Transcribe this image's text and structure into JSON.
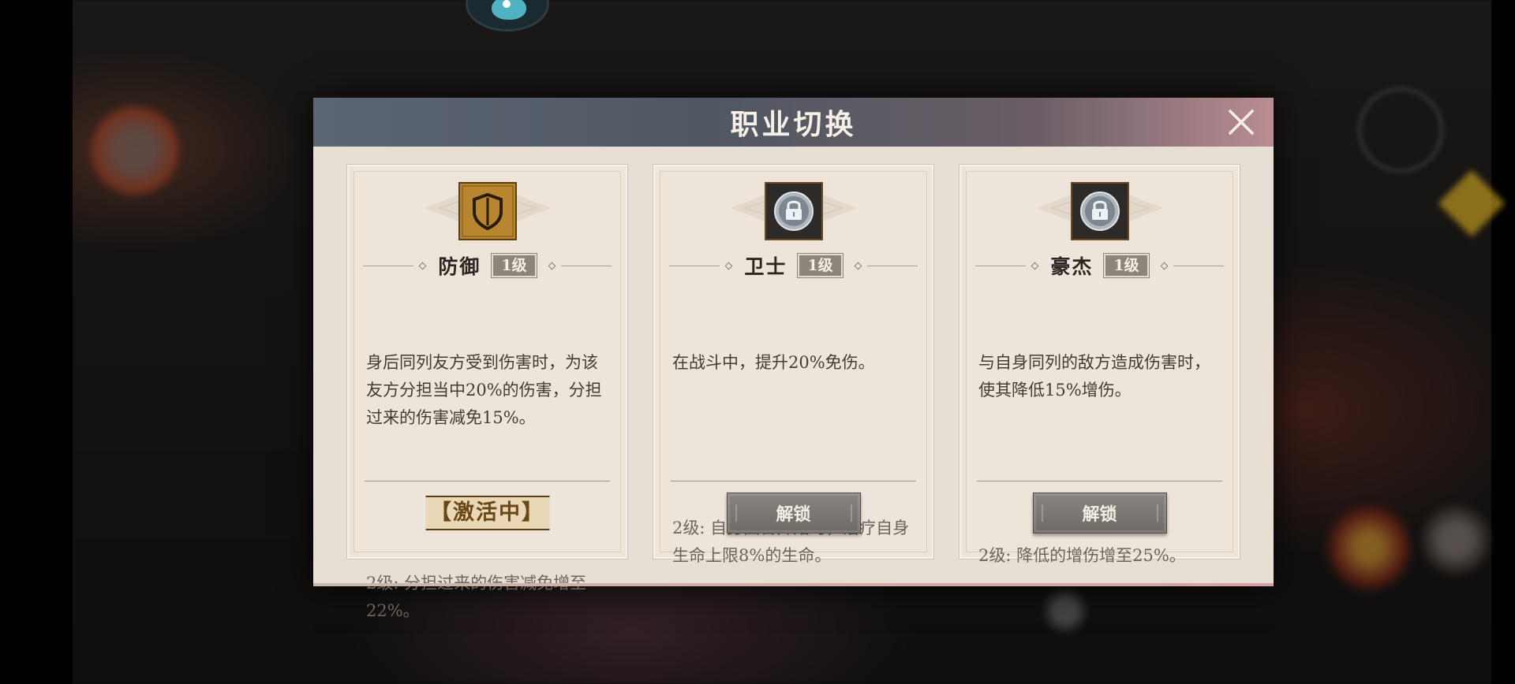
{
  "modal": {
    "title": "职业切换"
  },
  "cards": [
    {
      "name": "防御",
      "level": "1级",
      "icon": "shield-icon",
      "description": "身后同列友方受到伤害时，为该友方分担当中20%的伤害，分担过来的伤害减免15%。",
      "level2": "2级: 分担过来的伤害减免增至22%。",
      "status": "【激活中】",
      "state": "active"
    },
    {
      "name": "卫士",
      "level": "1级",
      "icon": "lock-icon",
      "description": "在战斗中，提升20%免伤。",
      "level2": "2级: 自身回合开始时，治疗自身生命上限8%的生命。",
      "button": "解锁",
      "state": "locked"
    },
    {
      "name": "豪杰",
      "level": "1级",
      "icon": "lock-icon",
      "description": "与自身同列的敌方造成伤害时，使其降低15%增伤。",
      "level2": "2级: 降低的增伤增至25%。",
      "button": "解锁",
      "state": "locked"
    }
  ],
  "colors": {
    "header_start": "#5c6672",
    "header_end": "#b98d92",
    "card_bg": "#ede5da",
    "shield_gold": "#b8862e",
    "active_brown": "#6a4714",
    "button_gray": "#7c7772"
  }
}
